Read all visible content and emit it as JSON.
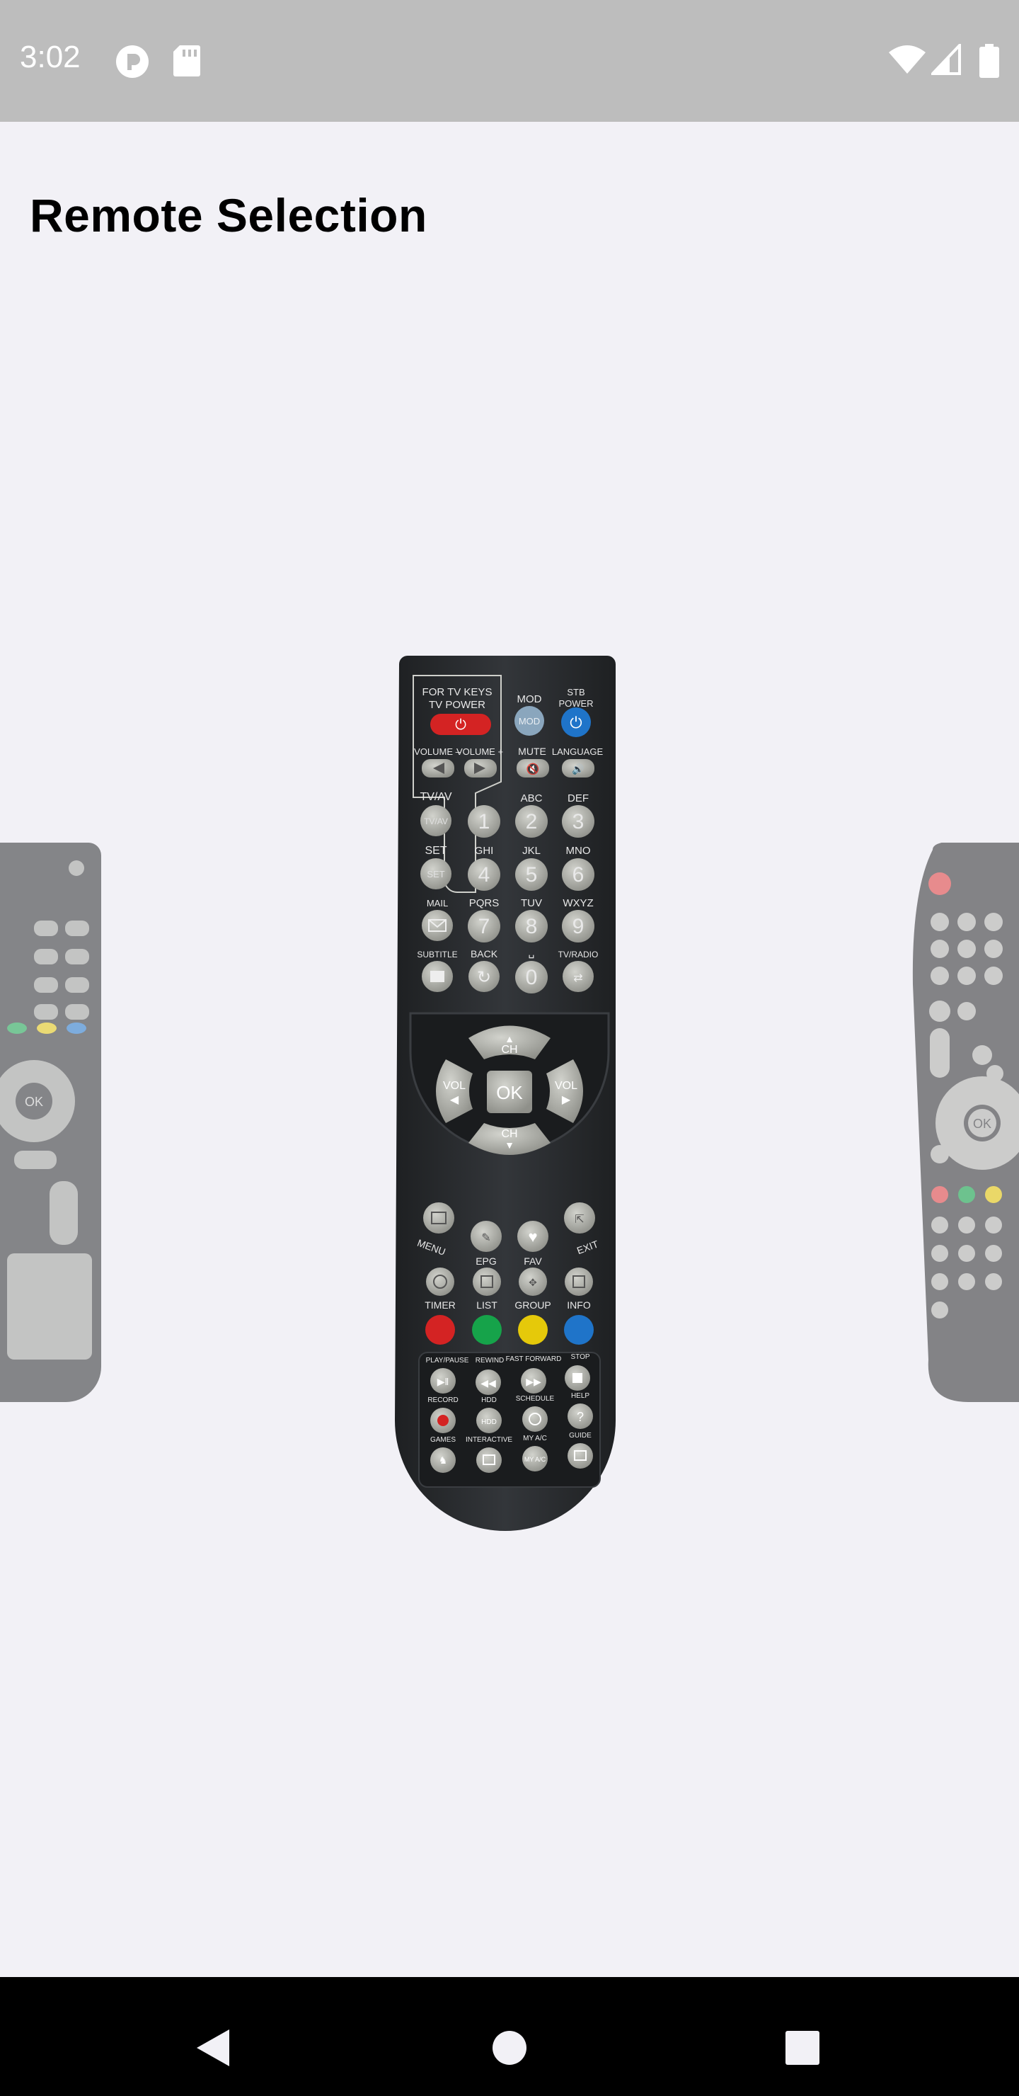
{
  "status_bar": {
    "time": "3:02",
    "icons": [
      "notification-icon",
      "sd-card-icon",
      "wifi-icon",
      "cell-signal-icon",
      "battery-icon"
    ]
  },
  "header": {
    "title": "Remote Selection"
  },
  "carousel": {
    "center_remote": {
      "tv_keys_label": "FOR TV KEYS\nTV POWER",
      "mod": "MOD",
      "stb_power": "STB\nPOWER",
      "volume_minus": "VOLUME –",
      "volume_plus": "VOLUME +",
      "mute": "MUTE",
      "language": "LANGUAGE",
      "tv_av": "TV/AV",
      "set": "SET",
      "abc": "ABC",
      "def": "DEF",
      "ghi": "GHI",
      "jkl": "JKL",
      "mno": "MNO",
      "mail": "MAIL",
      "pqrs": "PQRS",
      "tuv": "TUV",
      "wxyz": "WXYZ",
      "subtitle": "SUBTITLE",
      "back": "BACK",
      "tv_radio": "TV/RADIO",
      "digits": [
        "1",
        "2",
        "3",
        "4",
        "5",
        "6",
        "7",
        "8",
        "9",
        "0"
      ],
      "ch": "CH",
      "vol": "VOL",
      "ok": "OK",
      "menu": "MENU",
      "epg": "EPG",
      "fav": "FAV",
      "exit": "EXIT",
      "timer": "TIMER",
      "list": "LIST",
      "group": "GROUP",
      "info": "INFO",
      "play_pause": "PLAY/PAUSE",
      "rewind": "REWIND",
      "fast_forward": "FAST FORWARD",
      "stop": "STOP",
      "record": "RECORD",
      "hdd": "HDD",
      "schedule": "SCHEDULE",
      "help": "HELP",
      "games": "GAMES",
      "interactive": "INTERACTIVE",
      "my_ac": "MY A/C",
      "guide": "GUIDE"
    }
  },
  "colors": {
    "status_bar": "#bdbdbd",
    "background": "#f2f1f6",
    "remote_body": "#2b2d2f",
    "button_gray": "#a9aaa4",
    "red": "#d42323",
    "green": "#16a34a",
    "yellow": "#e5c90a",
    "blue": "#1f74c9"
  }
}
